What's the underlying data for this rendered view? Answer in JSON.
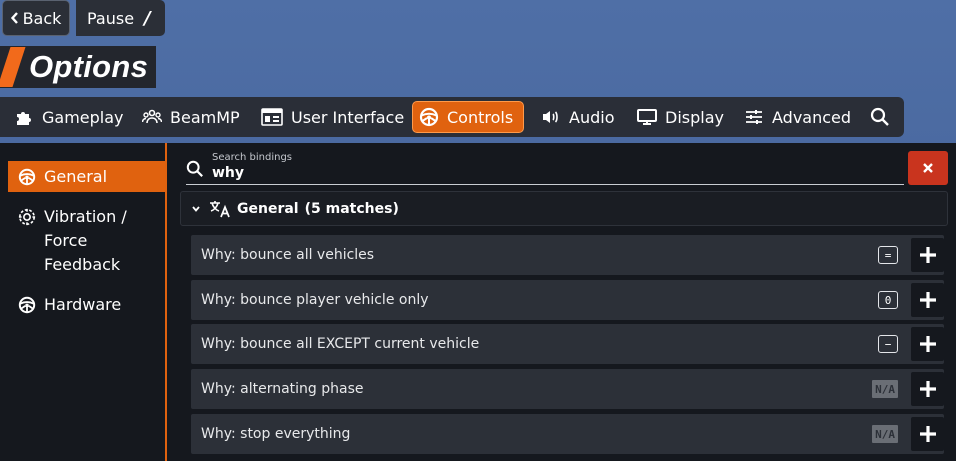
{
  "topbar": {
    "back_label": "Back",
    "pause_label": "Pause",
    "pause_extra": "/"
  },
  "title": "Options",
  "nav": [
    {
      "label": "Gameplay",
      "icon": "puzzle-icon"
    },
    {
      "label": "BeamMP",
      "icon": "users-icon"
    },
    {
      "label": "User Interface",
      "icon": "ui-icon"
    },
    {
      "label": "Controls",
      "icon": "steering-wheel-icon",
      "active": true
    },
    {
      "label": "Audio",
      "icon": "speaker-icon"
    },
    {
      "label": "Display",
      "icon": "monitor-icon"
    },
    {
      "label": "Advanced",
      "icon": "sliders-icon"
    }
  ],
  "sidebar": [
    {
      "label": "General",
      "icon": "steering-wheel-icon",
      "active": true
    },
    {
      "label_lines": [
        "Vibration /",
        "Force",
        "Feedback"
      ],
      "icon": "vibration-icon"
    },
    {
      "label": "Hardware",
      "icon": "steering-wheel-icon"
    }
  ],
  "search": {
    "label": "Search bindings",
    "value": "why"
  },
  "group": {
    "title": "General",
    "count": "(5 matches)"
  },
  "bindings": [
    {
      "label": "Why: bounce all vehicles",
      "key": "="
    },
    {
      "label": "Why: bounce player vehicle only",
      "key": "0"
    },
    {
      "label": "Why: bounce all EXCEPT current vehicle",
      "key": "−"
    },
    {
      "label": "Why: alternating phase",
      "key": "N/A"
    },
    {
      "label": "Why: stop everything",
      "key": "N/A"
    }
  ],
  "colors": {
    "accent": "#e0620f",
    "clear": "#c9341e",
    "panel": "#15181e",
    "row": "#2c3038"
  }
}
